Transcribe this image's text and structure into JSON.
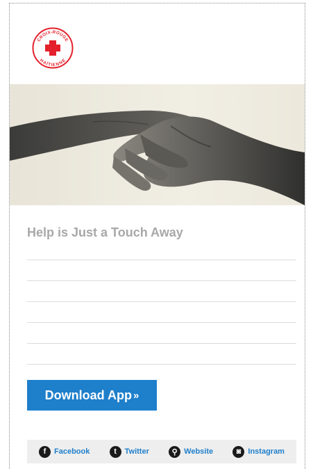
{
  "brand": {
    "logo_text_top": "CROIX-ROUGE",
    "logo_text_bottom": "HAÏTIENNE",
    "red": "#e3202b"
  },
  "hero": {
    "image": "two hands reaching and clasping, monochrome"
  },
  "content": {
    "headline": "Help is Just a Touch Away",
    "button_label": "Download App",
    "button_chevron": "»"
  },
  "social": [
    {
      "label": "Facebook",
      "icon": "facebook-icon",
      "glyph": "f"
    },
    {
      "label": "Twitter",
      "icon": "twitter-icon",
      "glyph": "t"
    },
    {
      "label": "Website",
      "icon": "link-icon",
      "glyph": "⚲"
    },
    {
      "label": "Instagram",
      "icon": "instagram-icon",
      "glyph": "◙"
    }
  ],
  "colors": {
    "accent": "#1e7fcb",
    "heading": "#a8a8a8",
    "social_bg": "#eeeeee"
  }
}
